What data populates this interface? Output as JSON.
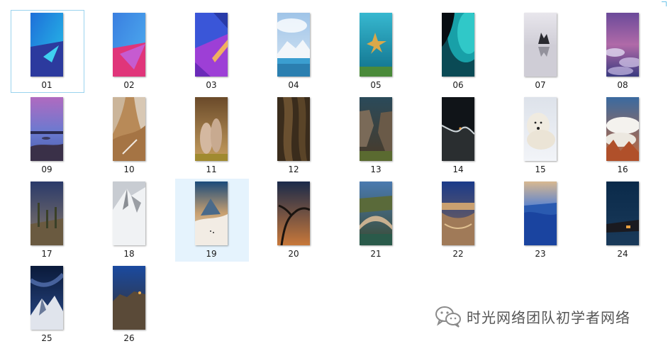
{
  "files": [
    {
      "name": "01",
      "state": "selected",
      "icon": "image-thumbnail-icon"
    },
    {
      "name": "02",
      "state": "normal",
      "icon": "image-thumbnail-icon"
    },
    {
      "name": "03",
      "state": "normal",
      "icon": "image-thumbnail-icon"
    },
    {
      "name": "04",
      "state": "normal",
      "icon": "image-thumbnail-icon"
    },
    {
      "name": "05",
      "state": "normal",
      "icon": "image-thumbnail-icon"
    },
    {
      "name": "06",
      "state": "normal",
      "icon": "image-thumbnail-icon"
    },
    {
      "name": "07",
      "state": "normal",
      "icon": "image-thumbnail-icon"
    },
    {
      "name": "08",
      "state": "normal",
      "icon": "image-thumbnail-icon"
    },
    {
      "name": "09",
      "state": "normal",
      "icon": "image-thumbnail-icon"
    },
    {
      "name": "10",
      "state": "normal",
      "icon": "image-thumbnail-icon"
    },
    {
      "name": "11",
      "state": "normal",
      "icon": "image-thumbnail-icon"
    },
    {
      "name": "12",
      "state": "normal",
      "icon": "image-thumbnail-icon"
    },
    {
      "name": "13",
      "state": "normal",
      "icon": "image-thumbnail-icon"
    },
    {
      "name": "14",
      "state": "normal",
      "icon": "image-thumbnail-icon"
    },
    {
      "name": "15",
      "state": "normal",
      "icon": "image-thumbnail-icon"
    },
    {
      "name": "16",
      "state": "normal",
      "icon": "image-thumbnail-icon"
    },
    {
      "name": "17",
      "state": "normal",
      "icon": "image-thumbnail-icon"
    },
    {
      "name": "18",
      "state": "normal",
      "icon": "image-thumbnail-icon"
    },
    {
      "name": "19",
      "state": "hovered",
      "icon": "image-thumbnail-icon"
    },
    {
      "name": "20",
      "state": "normal",
      "icon": "image-thumbnail-icon"
    },
    {
      "name": "21",
      "state": "normal",
      "icon": "image-thumbnail-icon"
    },
    {
      "name": "22",
      "state": "normal",
      "icon": "image-thumbnail-icon"
    },
    {
      "name": "23",
      "state": "normal",
      "icon": "image-thumbnail-icon"
    },
    {
      "name": "24",
      "state": "normal",
      "icon": "image-thumbnail-icon"
    },
    {
      "name": "25",
      "state": "normal",
      "icon": "image-thumbnail-icon"
    },
    {
      "name": "26",
      "state": "normal",
      "icon": "image-thumbnail-icon"
    }
  ],
  "watermark": {
    "icon": "wechat-icon",
    "text": "时光网络团队初学者网络"
  },
  "colors": {
    "selection_border": "#9bd3ee",
    "hover_background": "#e5f3fd"
  }
}
